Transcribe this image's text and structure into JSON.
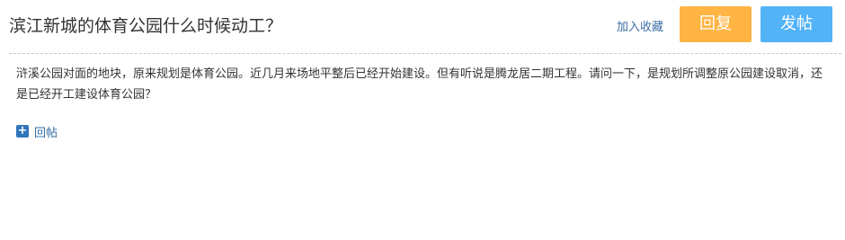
{
  "thread": {
    "title": "滨江新城的体育公园什么时候动工？",
    "favorite_label": "加入收藏",
    "reply_button": "回复",
    "post_button": "发帖",
    "body": "浒溪公园对面的地块，原来规划是体育公园。近几月来场地平整后已经开始建设。但有听说是腾龙居二期工程。请问一下，是规划所调整原公园建设取消，还是已经开工建设体育公园？",
    "reply_link": "回帖"
  },
  "colors": {
    "reply_button_bg": "#ffb444",
    "post_button_bg": "#52b3f7",
    "link": "#3d6fa6"
  },
  "icons": {
    "reply": "plus-icon"
  }
}
